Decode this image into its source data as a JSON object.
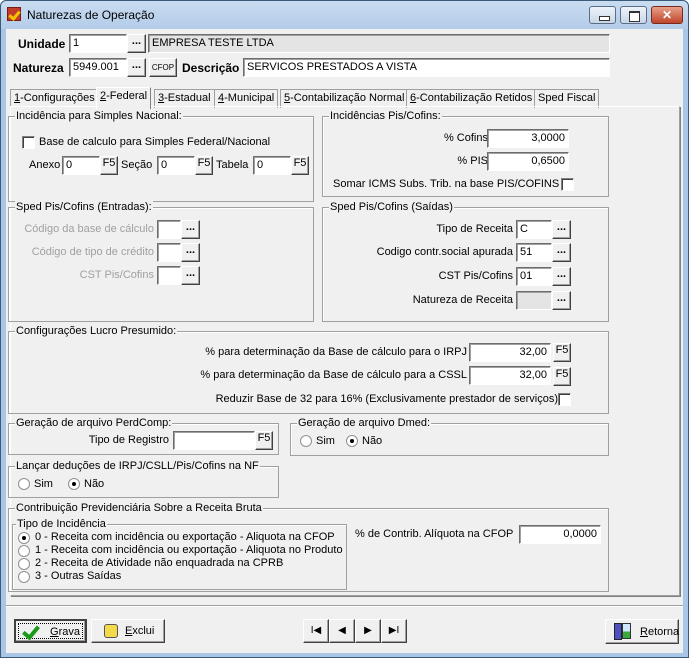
{
  "window": {
    "title": "Naturezas de Operação"
  },
  "header": {
    "unidade_label": "Unidade",
    "unidade_value": "1",
    "unidade_name": "EMPRESA TESTE LTDA",
    "natureza_label": "Natureza",
    "natureza_value": "5949.001",
    "cfop_button": "CFOP",
    "descricao_label": "Descrição",
    "descricao_value": "SERVICOS PRESTADOS A VISTA",
    "lookup_button": "..."
  },
  "tabs": [
    {
      "key": "1",
      "label": "-Configurações"
    },
    {
      "key": "2",
      "label": "-Federal"
    },
    {
      "key": "3",
      "label": "-Estadual"
    },
    {
      "key": "4",
      "label": "-Municipal"
    },
    {
      "key": "5",
      "label": "-Contabilização Normal"
    },
    {
      "key": "6",
      "label": "-Contabilização Retidos"
    },
    {
      "key": "",
      "label": "Sped Fiscal"
    }
  ],
  "simples": {
    "title": "Incidência para Simples Nacional:",
    "checkbox_label": "Base de calculo para Simples Federal/Nacional",
    "checked": false,
    "anexo_label": "Anexo",
    "anexo_value": "0",
    "secao_label": "Seção",
    "secao_value": "0",
    "tabela_label": "Tabela",
    "tabela_value": "0",
    "f5": "F5"
  },
  "pis_cofins": {
    "title": "Incidências Pis/Cofins:",
    "cofins_label": "% Cofins",
    "cofins_value": "3,0000",
    "pis_label": "% PIS",
    "pis_value": "0,6500",
    "somar_label": "Somar ICMS Subs. Trib. na base PIS/COFINS",
    "somar_checked": false
  },
  "sped_entradas": {
    "title": "Sped Pis/Cofins (Entradas):",
    "fields": [
      {
        "label": "Código da base de cálculo",
        "value": ""
      },
      {
        "label": "Código de tipo de crédito",
        "value": ""
      },
      {
        "label": "CST Pis/Cofins",
        "value": ""
      }
    ]
  },
  "sped_saidas": {
    "title": "Sped Pis/Cofins (Saídas)",
    "fields": [
      {
        "label": "Tipo de Receita",
        "value": "C"
      },
      {
        "label": "Codigo contr.social apurada",
        "value": "51"
      },
      {
        "label": "CST Pis/Cofins",
        "value": "01"
      },
      {
        "label": "Natureza de Receita",
        "value": ""
      }
    ]
  },
  "lucro": {
    "title": "Configurações Lucro Presumido:",
    "irpj_label": "% para determinação da Base de cálculo para o IRPJ",
    "irpj_value": "32,00",
    "cssl_label": "% para determinação da Base de cálculo para a CSSL",
    "cssl_value": "32,00",
    "reduzir_label": "Reduzir Base de 32 para 16% (Exclusivamente prestador de serviços)",
    "reduzir_checked": false
  },
  "perdcomp": {
    "title": "Geração de arquivo PerdComp:",
    "tipo_label": "Tipo de Registro",
    "tipo_value": ""
  },
  "dmed": {
    "title": "Geração de arquivo Dmed:",
    "sim": "Sim",
    "nao": "Não",
    "selected": "Não"
  },
  "deducoes": {
    "title": "Lançar deduções de IRPJ/CSLL/Pis/Cofins na NF",
    "sim": "Sim",
    "nao": "Não",
    "selected": "Não"
  },
  "cprb": {
    "title": "Contribuição Previdenciária Sobre a Receita Bruta",
    "tipo_title": "Tipo de Incidência",
    "options": [
      "0 - Receita com incidência ou exportação - Aliquota na CFOP",
      "1 - Receita com incidência ou exportação - Aliquota no Produto",
      "2 - Receita de Atividade não enquadrada na CPRB",
      "3 - Outras Saídas"
    ],
    "selected_index": 0,
    "aliquota_label": "% de Contrib. Alíquota na CFOP",
    "aliquota_value": "0,0000"
  },
  "footer": {
    "grava_key": "G",
    "grava_rest": "rava",
    "exclui_key": "E",
    "exclui_rest": "xclui",
    "retorna_key": "R",
    "retorna_rest": "etorna"
  }
}
